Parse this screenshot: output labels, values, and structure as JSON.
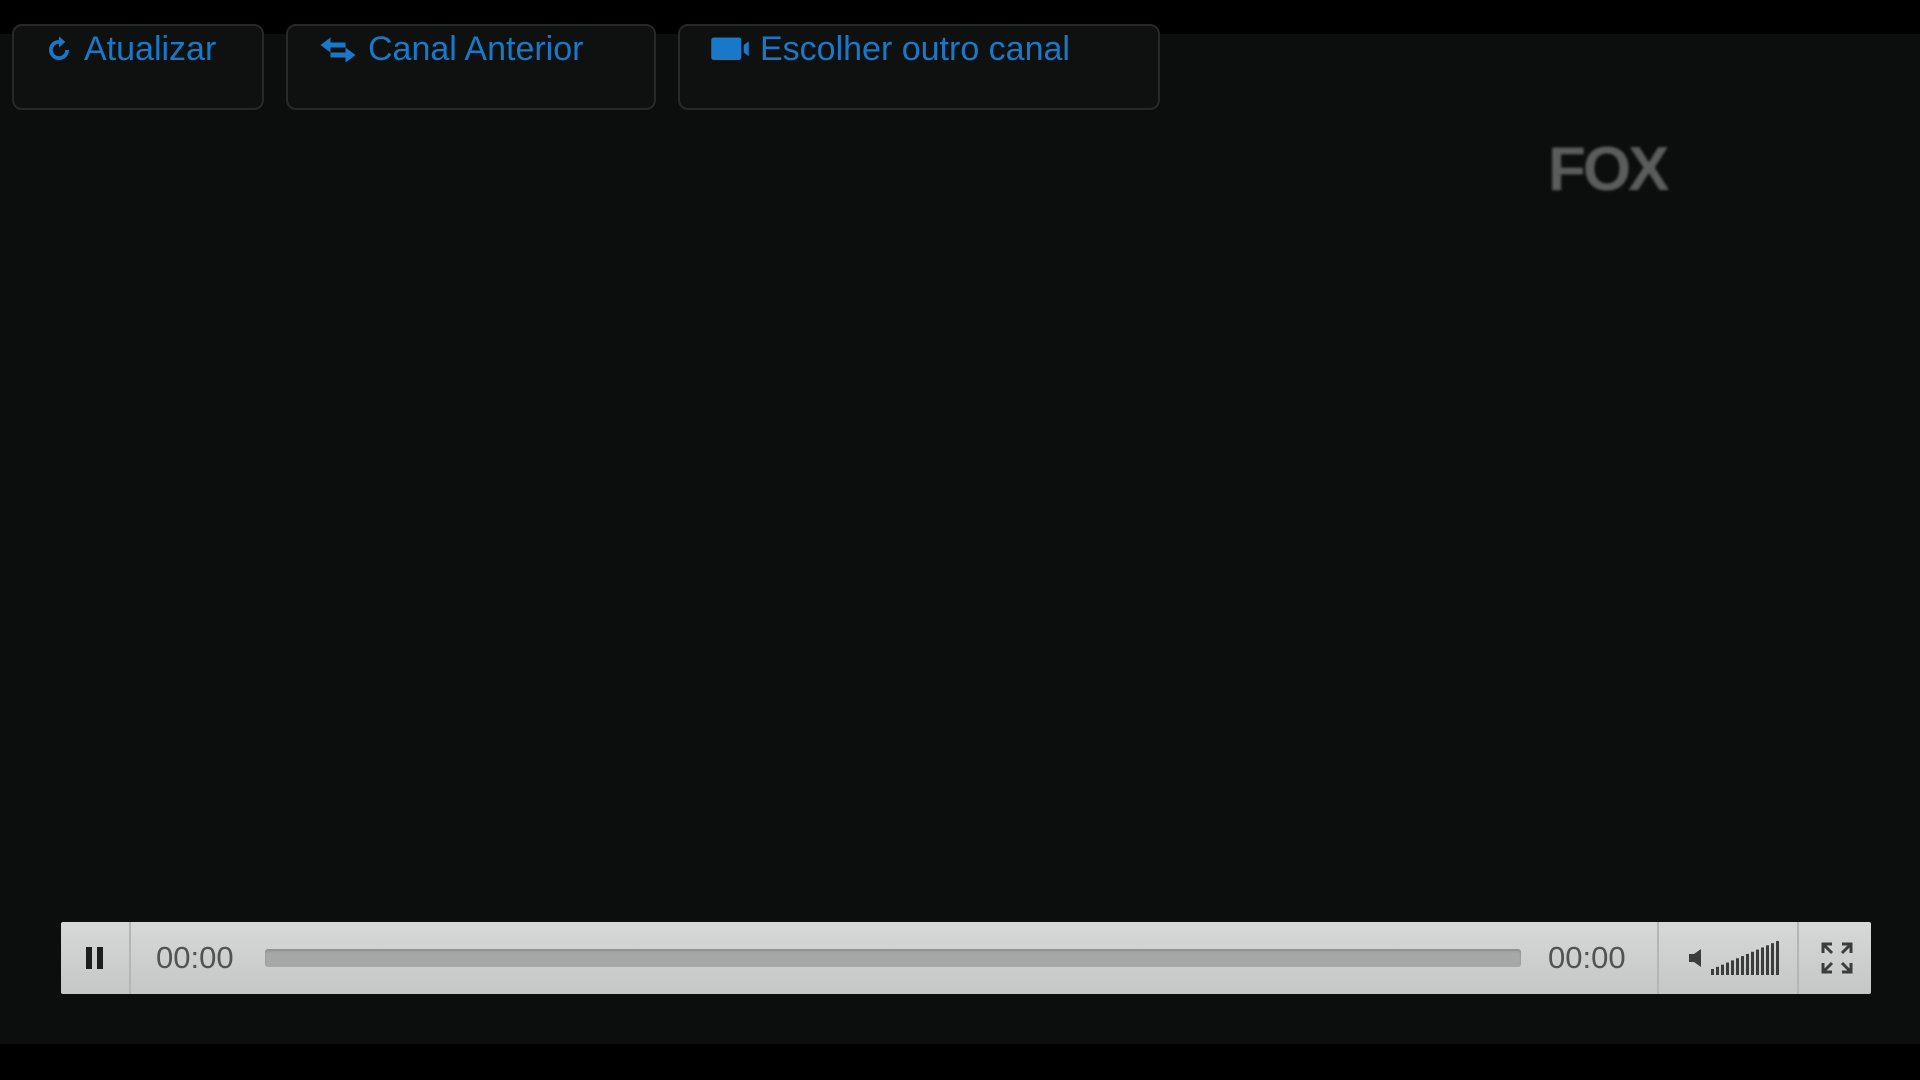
{
  "toolbar": {
    "refresh_label": "Atualizar",
    "previous_channel_label": "Canal Anterior",
    "choose_other_label": "Escolher outro canal"
  },
  "video": {
    "channel_logo": "FOX"
  },
  "player": {
    "current_time": "00:00",
    "duration": "00:00",
    "progress": 0,
    "volume": 1.0,
    "state": "playing"
  },
  "icons": {
    "refresh": "refresh-icon",
    "previous": "swap-icon",
    "choose": "tv-icon",
    "pause": "pause-icon",
    "mute": "speaker-icon",
    "fullscreen": "fullscreen-icon"
  },
  "colors": {
    "toolbar_text": "#1a78c9",
    "video_bg": "#0b0e0c",
    "controls_bg": "#d0d3d2",
    "controls_text": "#505453"
  }
}
